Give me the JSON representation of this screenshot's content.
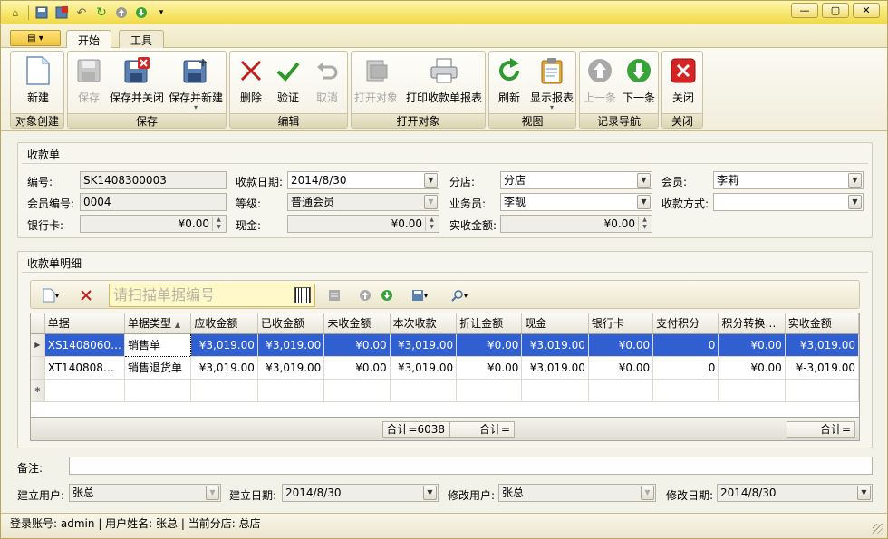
{
  "quick_access": [
    "app-icon",
    "save-icon",
    "save-close-icon",
    "undo-icon",
    "refresh-icon",
    "up-icon",
    "down-icon",
    "customize-icon"
  ],
  "window_buttons": [
    "minimize",
    "maximize",
    "close"
  ],
  "tabs": [
    {
      "label": "开始"
    },
    {
      "label": "工具"
    }
  ],
  "ribbon": {
    "groups": [
      {
        "label": "对象创建",
        "buttons": [
          {
            "label": "新建",
            "enabled": true,
            "icon": "new-doc-icon"
          }
        ]
      },
      {
        "label": "保存",
        "buttons": [
          {
            "label": "保存",
            "enabled": false,
            "icon": "save-icon"
          },
          {
            "label": "保存并关闭",
            "enabled": true,
            "icon": "save-close-icon"
          },
          {
            "label": "保存并新建",
            "enabled": true,
            "icon": "save-new-icon"
          }
        ]
      },
      {
        "label": "编辑",
        "buttons": [
          {
            "label": "删除",
            "enabled": true,
            "icon": "delete-icon"
          },
          {
            "label": "验证",
            "enabled": true,
            "icon": "check-icon"
          },
          {
            "label": "取消",
            "enabled": false,
            "icon": "undo-icon"
          }
        ]
      },
      {
        "label": "打开对象",
        "buttons": [
          {
            "label": "打开对象",
            "enabled": false,
            "icon": "open-icon"
          },
          {
            "label": "打印收款单报表",
            "enabled": true,
            "icon": "print-icon"
          }
        ]
      },
      {
        "label": "视图",
        "buttons": [
          {
            "label": "刷新",
            "enabled": true,
            "icon": "refresh-icon"
          },
          {
            "label": "显示报表",
            "enabled": true,
            "icon": "report-icon"
          }
        ]
      },
      {
        "label": "记录导航",
        "buttons": [
          {
            "label": "上一条",
            "enabled": false,
            "icon": "up-icon"
          },
          {
            "label": "下一条",
            "enabled": true,
            "icon": "down-icon"
          }
        ]
      },
      {
        "label": "关闭",
        "buttons": [
          {
            "label": "关闭",
            "enabled": true,
            "icon": "close-icon"
          }
        ]
      }
    ]
  },
  "header_section": {
    "title": "收款单",
    "fields": {
      "number_label": "编号:",
      "number": "SK1408300003",
      "date_label": "收款日期:",
      "date": "2014/8/30",
      "branch_label": "分店:",
      "branch": "分店",
      "member_label": "会员:",
      "member": "李莉",
      "member_no_label": "会员编号:",
      "member_no": "0004",
      "level_label": "等级:",
      "level": "普通会员",
      "salesman_label": "业务员:",
      "salesman": "李靓",
      "pay_method_label": "收款方式:",
      "pay_method": "",
      "bank_card_label": "银行卡:",
      "bank_card": "¥0.00",
      "cash_label": "现金:",
      "cash": "¥0.00",
      "actual_label": "实收金额:",
      "actual": "¥0.00"
    }
  },
  "detail_section": {
    "title": "收款单明细",
    "scan_placeholder": "请扫描单据编号",
    "columns": [
      "单据",
      "单据类型",
      "应收金额",
      "已收金额",
      "未收金额",
      "本次收款",
      "折让金额",
      "现金",
      "银行卡",
      "支付积分",
      "积分转换…",
      "实收金额"
    ],
    "rows": [
      [
        "XS1408060…",
        "销售单",
        "¥3,019.00",
        "¥3,019.00",
        "¥0.00",
        "¥3,019.00",
        "¥0.00",
        "¥3,019.00",
        "¥0.00",
        "0",
        "¥0.00",
        "¥3,019.00"
      ],
      [
        "XT140808…",
        "销售退货单",
        "¥3,019.00",
        "¥3,019.00",
        "¥0.00",
        "¥3,019.00",
        "¥0.00",
        "¥3,019.00",
        "¥0.00",
        "0",
        "¥0.00",
        "¥-3,019.00"
      ]
    ],
    "footer": {
      "sum1": "合计=6038",
      "sum2": "合计=",
      "sum3": "合计="
    }
  },
  "bottom": {
    "remark_label": "备注:",
    "remark": "",
    "creator_label": "建立用户:",
    "creator": "张总",
    "created_label": "建立日期:",
    "created": "2014/8/30",
    "modifier_label": "修改用户:",
    "modifier": "张总",
    "modified_label": "修改日期:",
    "modified": "2014/8/30"
  },
  "status": {
    "login_label": "登录账号:",
    "login": "admin",
    "user_label": "用户姓名:",
    "user": "张总",
    "branch_label": "当前分店:",
    "branch": "总店"
  }
}
